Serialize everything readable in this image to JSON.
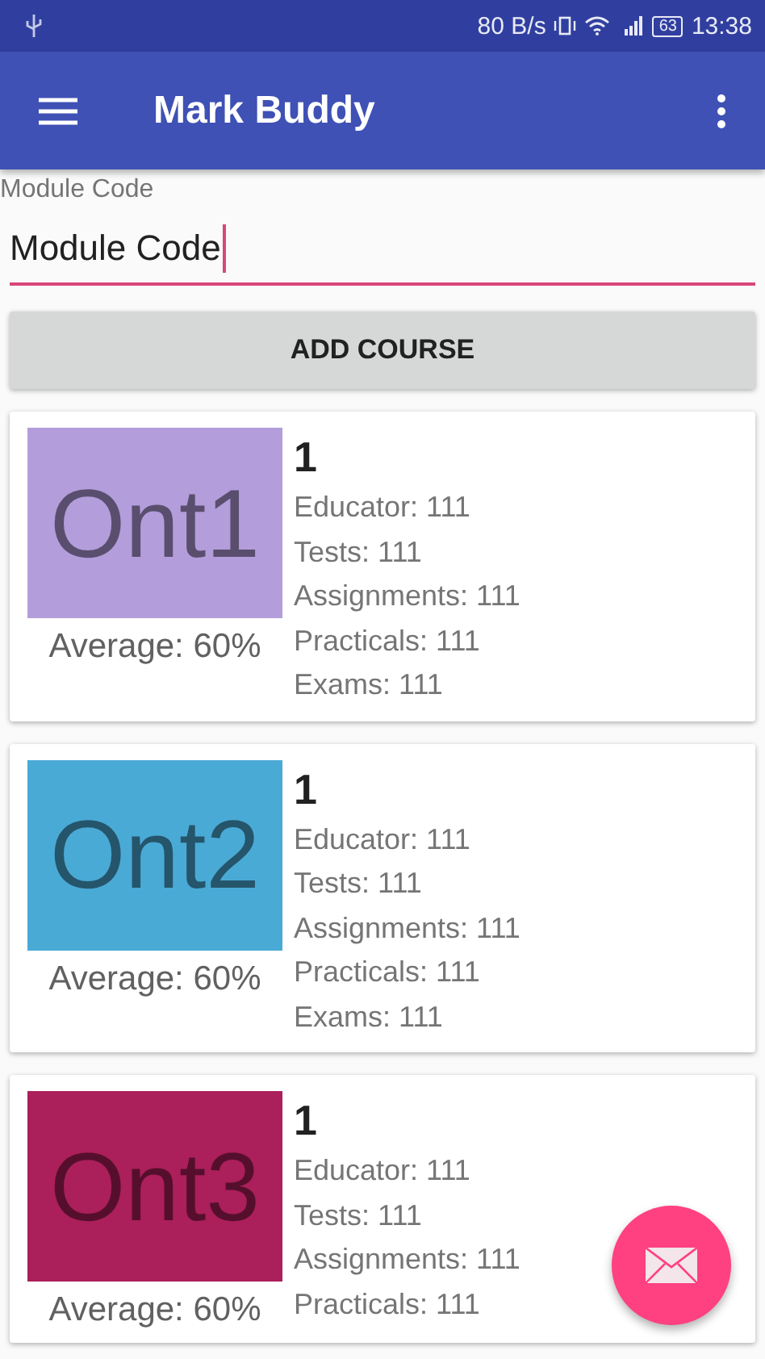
{
  "status_bar": {
    "speed": "80 B/s",
    "battery": "63",
    "time": "13:38"
  },
  "app_bar": {
    "title": "Mark Buddy"
  },
  "module_field": {
    "label": "Module Code",
    "value": "Module Code"
  },
  "add_button": "ADD COURSE",
  "courses": [
    {
      "code": "Ont1",
      "color": "#b39ddb",
      "average": "Average: 60%",
      "title": "1",
      "details": [
        "Educator: 111",
        "Tests: 111",
        "Assignments: 111",
        "Practicals: 111",
        "Exams: 111"
      ]
    },
    {
      "code": "Ont2",
      "color": "#4aaad6",
      "average": "Average: 60%",
      "title": "1",
      "details": [
        "Educator: 111",
        "Tests: 111",
        "Assignments: 111",
        "Practicals: 111",
        "Exams: 111"
      ]
    },
    {
      "code": "Ont3",
      "color": "#ab1f5a",
      "average": "Average: 60%",
      "title": "1",
      "details": [
        "Educator: 111",
        "Tests: 111",
        "Assignments: 111",
        "Practicals: 111"
      ]
    }
  ]
}
